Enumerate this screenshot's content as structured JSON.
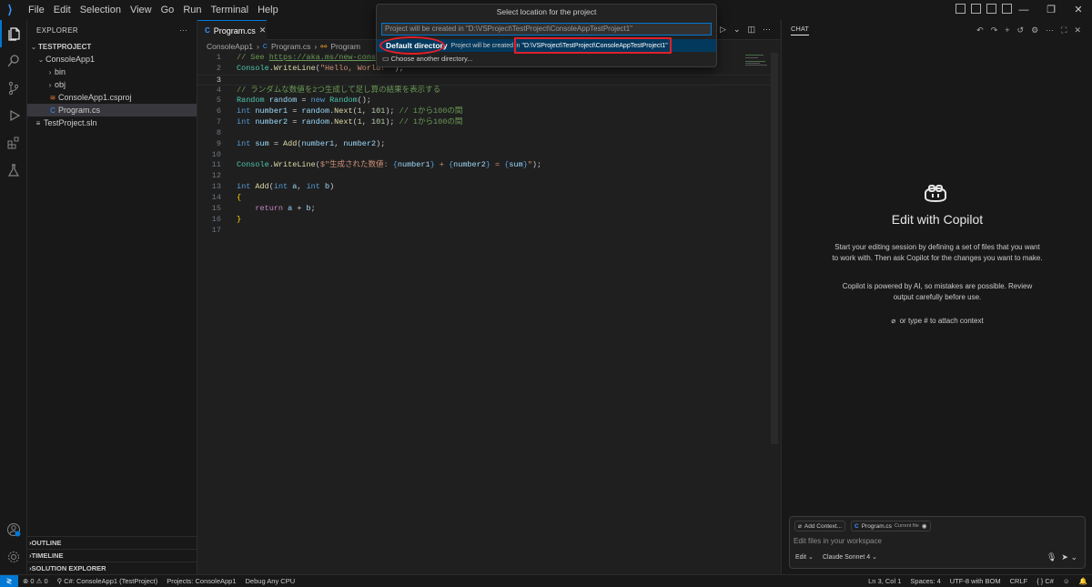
{
  "menu": [
    "File",
    "Edit",
    "Selection",
    "View",
    "Go",
    "Run",
    "Terminal",
    "Help"
  ],
  "quickpick": {
    "title": "Select location for the project",
    "placeholder": "Project will be created in \"D:\\VSProject\\TestProject\\ConsoleAppTestProject1\"",
    "item1_label": "Default directory",
    "item1_desc": "Project will be created in",
    "item1_path": "\"D:\\VSProject\\TestProject\\ConsoleAppTestProject1\"",
    "item2_label": "Choose another directory..."
  },
  "explorer": {
    "header": "EXPLORER",
    "root": "TESTPROJECT",
    "items": [
      "ConsoleApp1",
      "bin",
      "obj",
      "ConsoleApp1.csproj",
      "Program.cs",
      "TestProject.sln"
    ],
    "sections": [
      "OUTLINE",
      "TIMELINE",
      "SOLUTION EXPLORER"
    ]
  },
  "editor": {
    "tab": "Program.cs",
    "crumbs": [
      "ConsoleApp1",
      "Program.cs",
      "Program"
    ],
    "line_numbers": [
      "1",
      "2",
      "3",
      "4",
      "5",
      "6",
      "7",
      "8",
      "9",
      "10",
      "11",
      "12",
      "13",
      "14",
      "15",
      "16",
      "17"
    ]
  },
  "chat": {
    "tab": "CHAT",
    "title": "Edit with Copilot",
    "p1": "Start your editing session by defining a set of files that you want to work with. Then ask Copilot for the changes you want to make.",
    "p2": "Copilot is powered by AI, so mistakes are possible. Review output carefully before use.",
    "hint": "or type # to attach context",
    "chip1": "Add Context...",
    "chip2": "Program.cs",
    "chip2_sub": "Current file",
    "placeholder": "Edit files in your workspace",
    "mode": "Edit",
    "model": "Claude Sonnet 4"
  },
  "status": {
    "problems": "0",
    "warnings": "0",
    "project": "C#: ConsoleApp1 (TestProject)",
    "projects": "Projects: ConsoleApp1",
    "config": "Debug Any CPU",
    "position": "Ln 3, Col 1",
    "spaces": "Spaces: 4",
    "encoding": "UTF-8 with BOM",
    "eol": "CRLF",
    "lang": "C#"
  },
  "colors": {
    "accent": "#0078d4",
    "highlight": "#e0202a",
    "selection": "#04395e"
  }
}
